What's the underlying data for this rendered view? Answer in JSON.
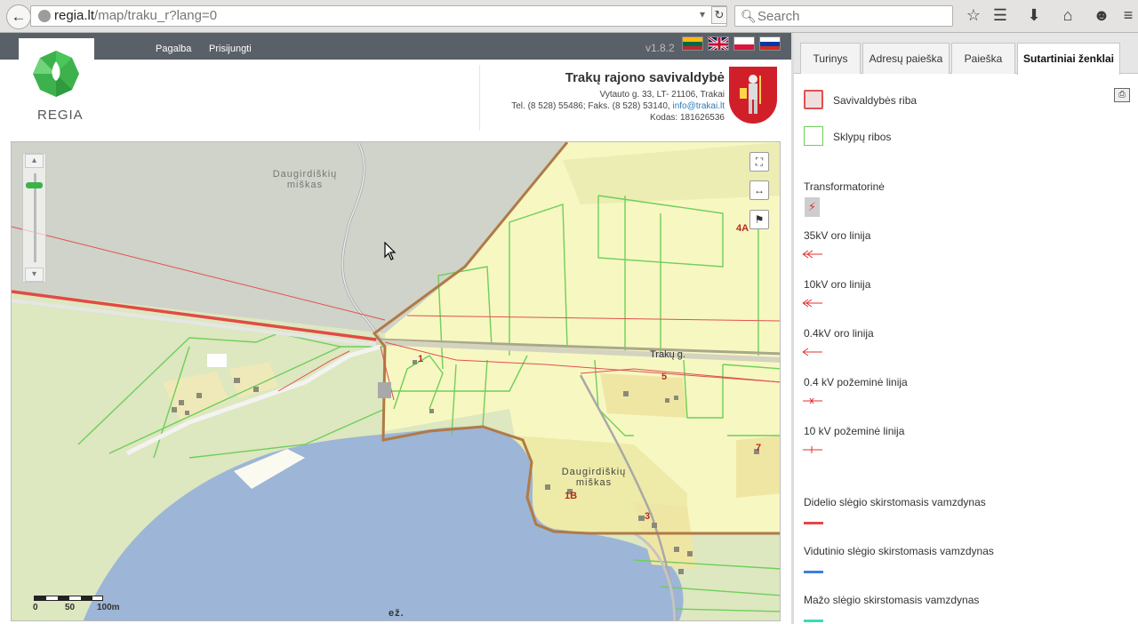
{
  "browser": {
    "url_host": "regia.lt",
    "url_path": "/map/traku_r?lang=0",
    "search_placeholder": "Search"
  },
  "site": {
    "logo_text": "REGIA",
    "nav": [
      "Pagalba",
      "Prisijungti"
    ],
    "version": "v1.8.2",
    "languages": [
      "lt",
      "en",
      "pl",
      "ru"
    ]
  },
  "municipality": {
    "title": "Trakų rajono savivaldybė",
    "address": "Vytauto g. 33, LT- 21106, Trakai",
    "phone_fax": "Tel. (8 528) 55486; Faks. (8 528) 53140,",
    "email": "info@trakai.lt",
    "code": "Kodas: 181626536"
  },
  "map": {
    "labels": {
      "forest_nw": "Daugirdiškių\nmiškas",
      "forest_s": "Daugirdiškių\nmiškas",
      "street": "Trakų g.",
      "lake": "ež."
    },
    "parcel_numbers": [
      "4A",
      "1",
      "5",
      "7",
      "1B",
      "3"
    ],
    "scale_labels": [
      "0",
      "50",
      "100m"
    ]
  },
  "panel": {
    "tabs": [
      "Turinys",
      "Adresų paieška",
      "Paieška",
      "Sutartiniai ženklai"
    ],
    "active_tab": "Sutartiniai ženklai",
    "legend": [
      {
        "label": "Savivaldybės riba",
        "color": "#e05050"
      },
      {
        "label": "Sklypų ribos",
        "color": "#6ecf5a"
      },
      {
        "label": "Transformatorinė",
        "color": "#e03030"
      },
      {
        "label": "35kV oro linija",
        "color": "#e03030"
      },
      {
        "label": "10kV oro linija",
        "color": "#e03030"
      },
      {
        "label": "0.4kV oro linija",
        "color": "#e03030"
      },
      {
        "label": "0.4 kV požeminė linija",
        "color": "#e03030"
      },
      {
        "label": "10 kV požeminė linija",
        "color": "#e03030"
      },
      {
        "label": "Didelio slėgio skirstomasis vamzdynas",
        "color": "#e64646"
      },
      {
        "label": "Vidutinio slėgio skirstomasis vamzdynas",
        "color": "#3f7fe0"
      },
      {
        "label": "Mažo slėgio skirstomasis vamzdynas",
        "color": "#40d8b8"
      }
    ]
  }
}
